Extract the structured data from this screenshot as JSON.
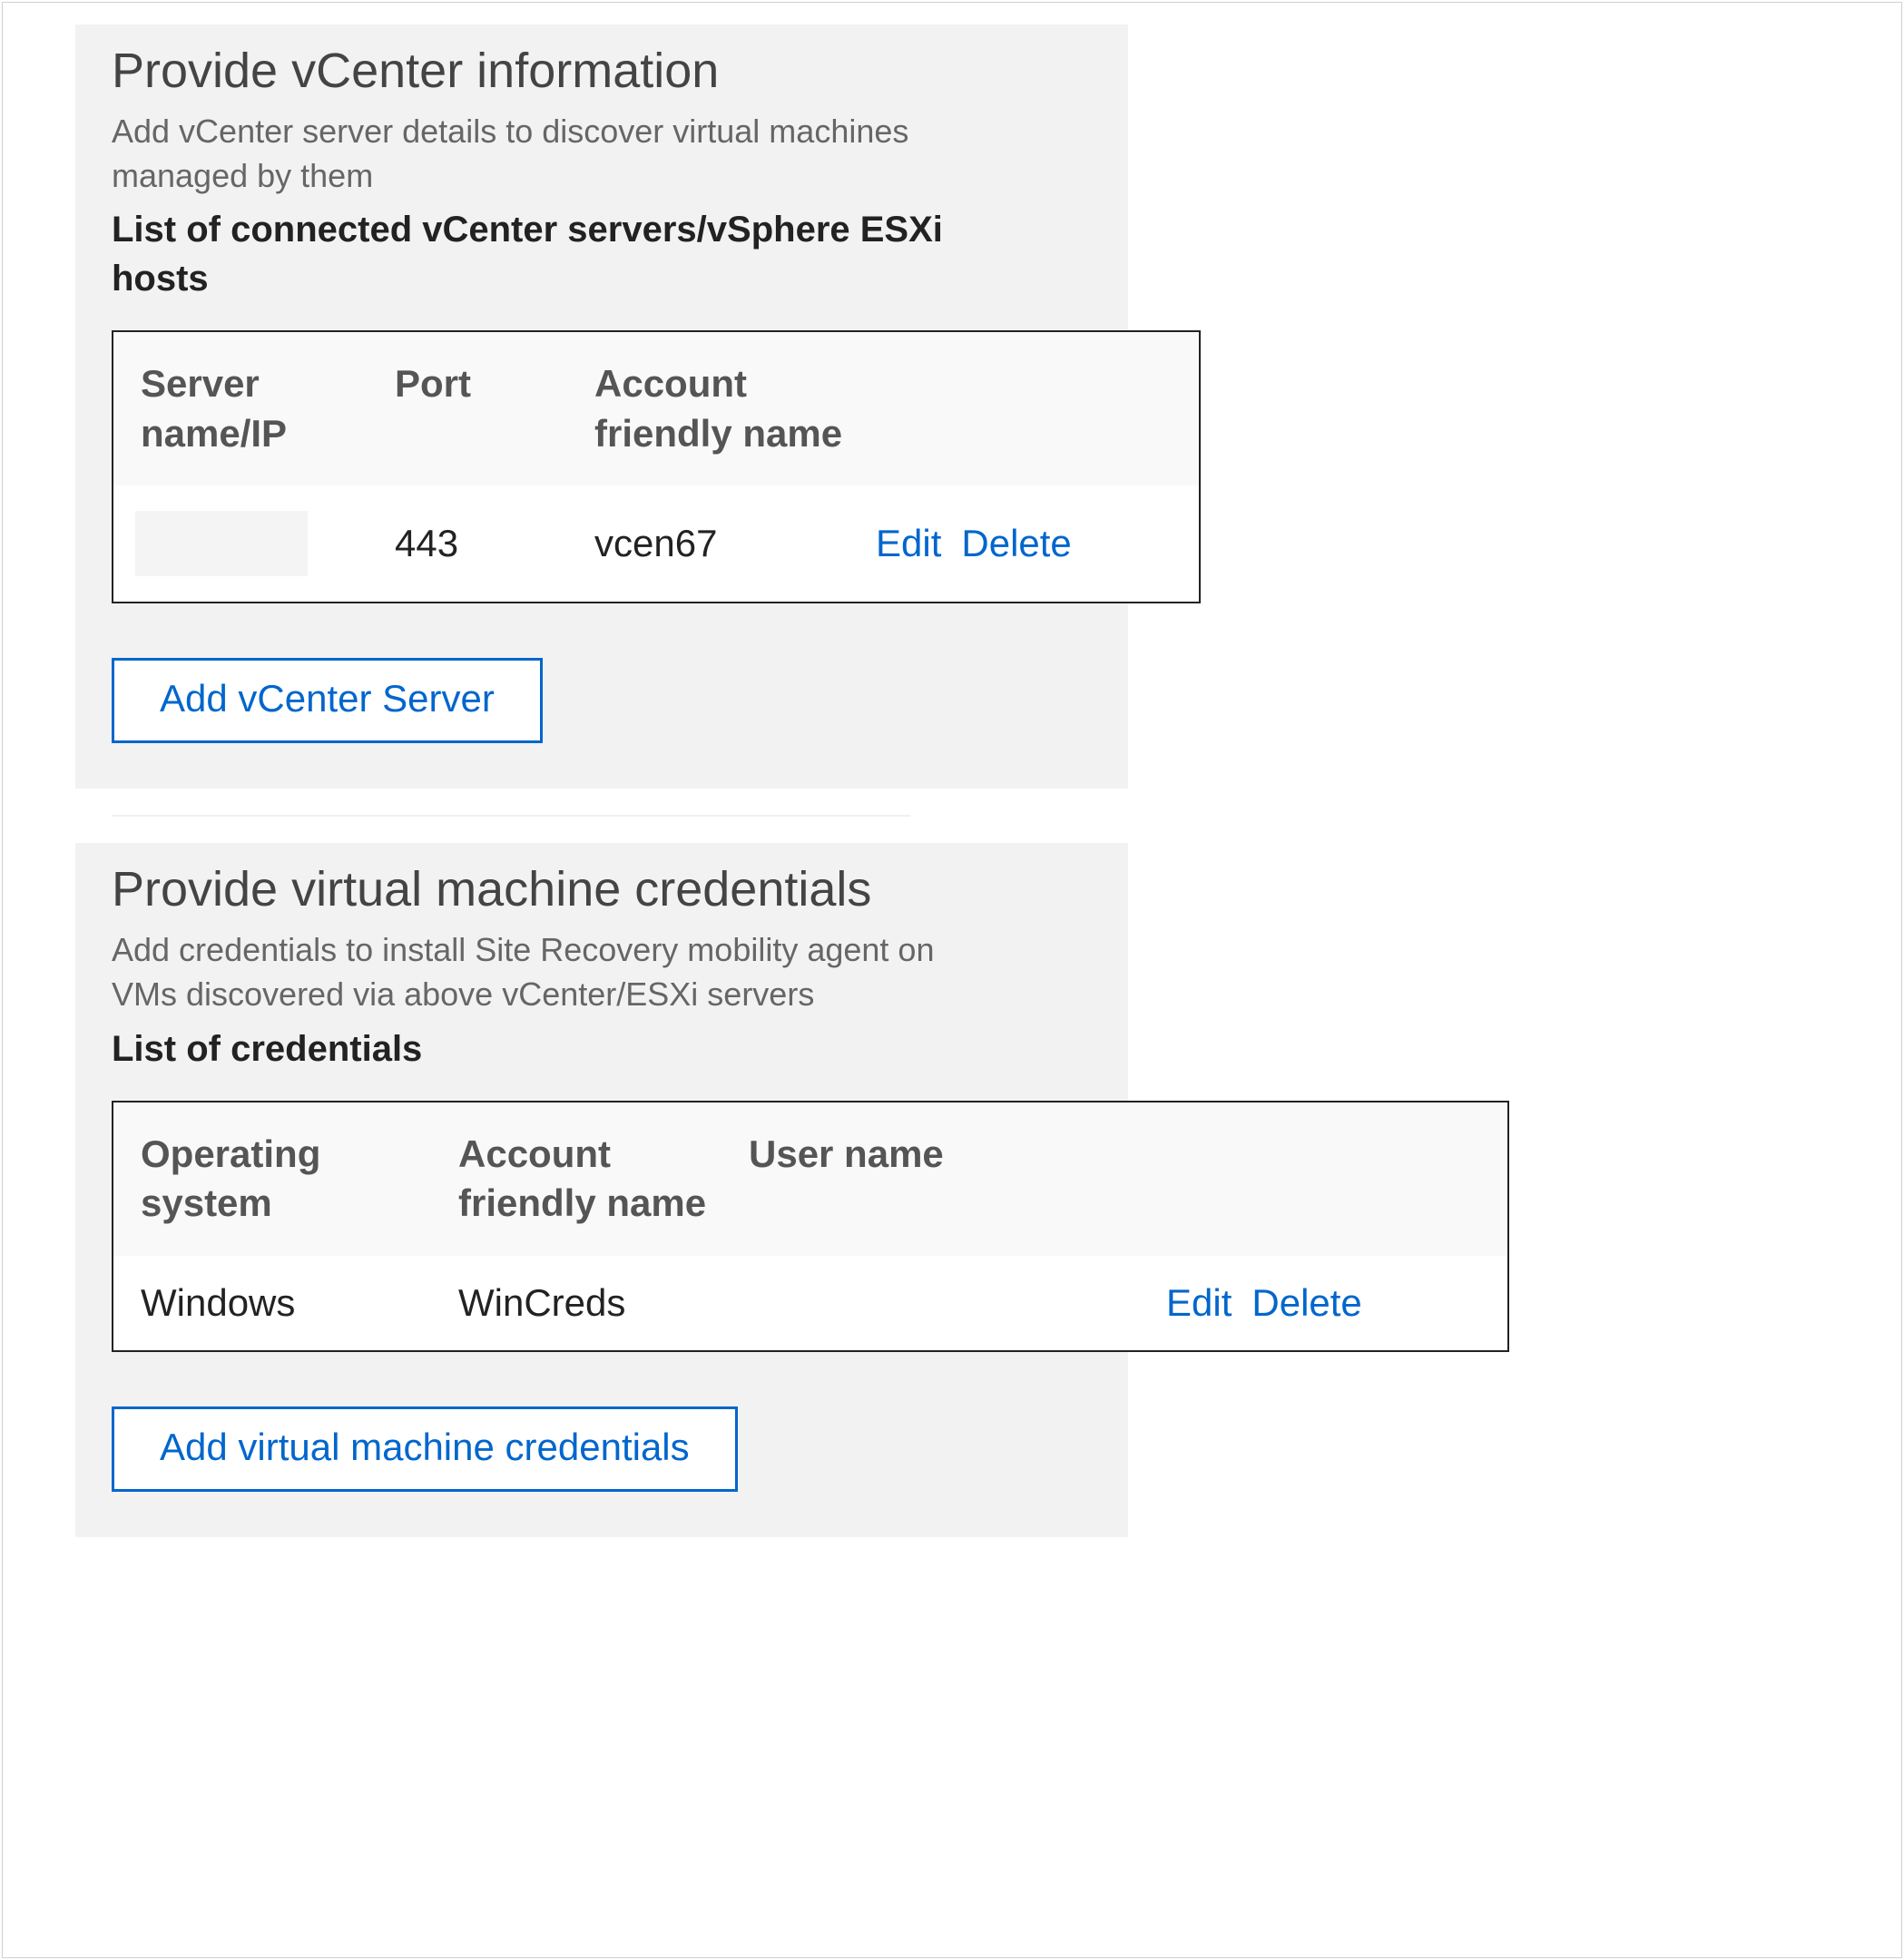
{
  "section1": {
    "title": "Provide vCenter information",
    "description": "Add vCenter server details to discover virtual machines managed by them",
    "list_label": "List of connected vCenter servers/vSphere ESXi hosts",
    "table": {
      "headers": {
        "server": "Server name/IP",
        "port": "Port",
        "account": "Account friendly name"
      },
      "row": {
        "server": "",
        "port": "443",
        "account": "vcen67",
        "edit": "Edit",
        "delete": "Delete"
      }
    },
    "add_button": "Add vCenter Server"
  },
  "section2": {
    "title": "Provide virtual machine credentials",
    "description": "Add credentials to install Site Recovery mobility agent on VMs discovered via above vCenter/ESXi servers",
    "list_label": "List of credentials",
    "table": {
      "headers": {
        "os": "Operating system",
        "account": "Account friendly name",
        "user": "User name"
      },
      "row": {
        "os": "Windows",
        "account": "WinCreds",
        "user": "",
        "edit": "Edit",
        "delete": "Delete"
      }
    },
    "add_button": "Add virtual machine credentials"
  }
}
